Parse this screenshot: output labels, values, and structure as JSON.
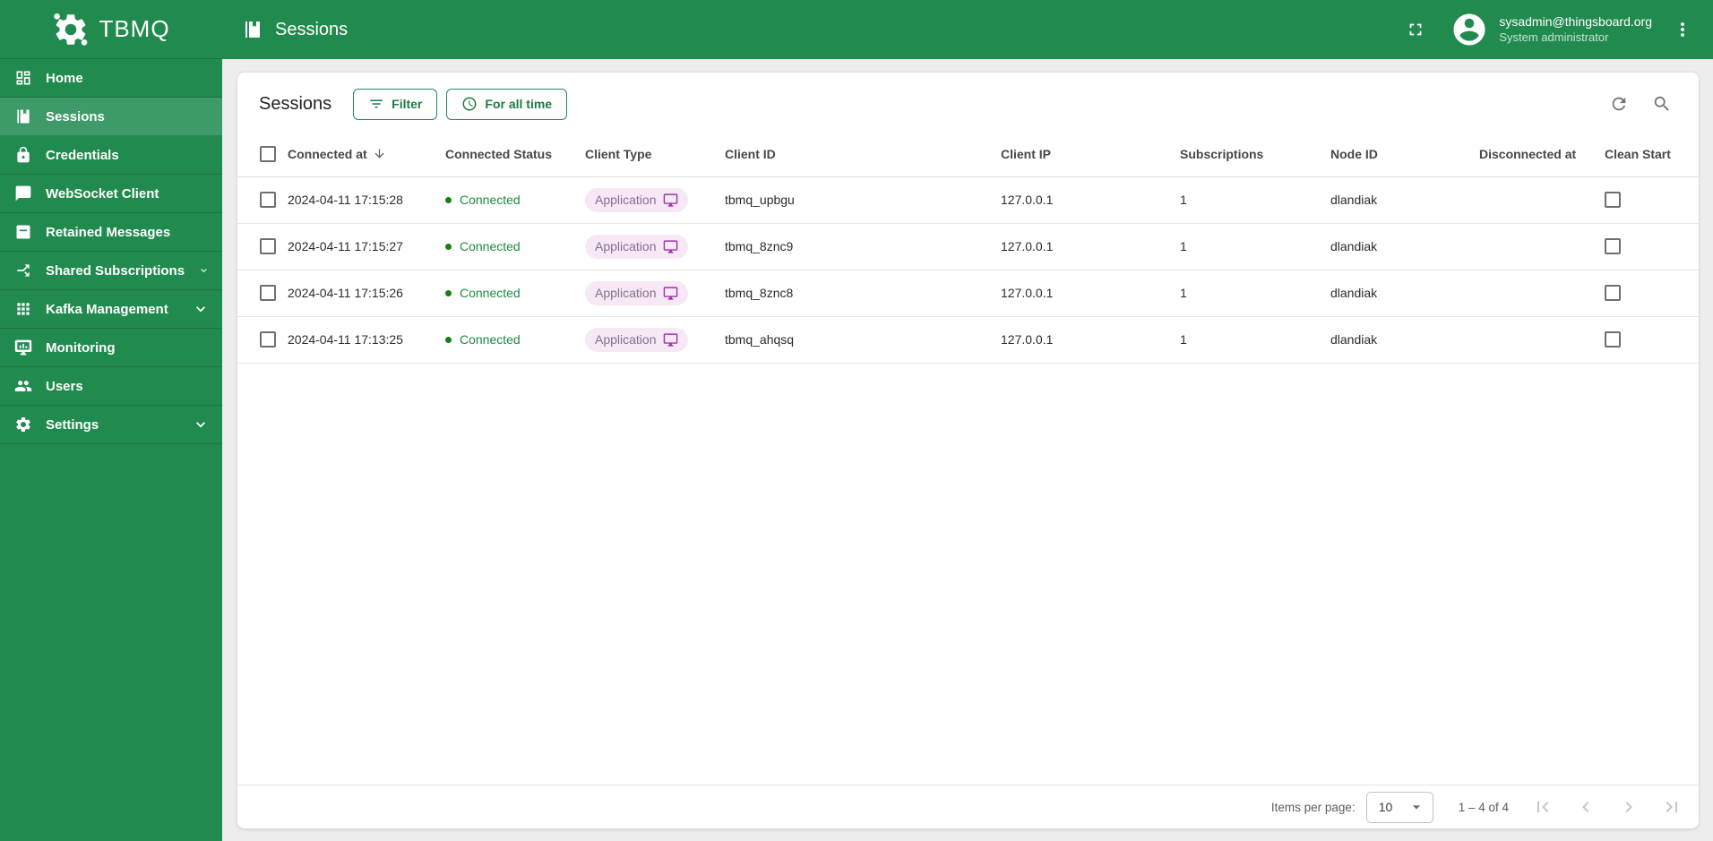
{
  "sidebar": {
    "logo_text": "TBMQ",
    "items": [
      {
        "label": "Home",
        "slug": "home",
        "icon": "dashboard",
        "active": false,
        "expandable": false
      },
      {
        "label": "Sessions",
        "slug": "sessions",
        "icon": "book",
        "active": true,
        "expandable": false
      },
      {
        "label": "Credentials",
        "slug": "credentials",
        "icon": "lock",
        "active": false,
        "expandable": false
      },
      {
        "label": "WebSocket Client",
        "slug": "websocket-client",
        "icon": "chat",
        "active": false,
        "expandable": false
      },
      {
        "label": "Retained Messages",
        "slug": "retained-messages",
        "icon": "archive",
        "active": false,
        "expandable": false
      },
      {
        "label": "Shared Subscriptions",
        "slug": "shared-subscriptions",
        "icon": "split",
        "active": false,
        "expandable": true
      },
      {
        "label": "Kafka Management",
        "slug": "kafka-management",
        "icon": "apps",
        "active": false,
        "expandable": true
      },
      {
        "label": "Monitoring",
        "slug": "monitoring",
        "icon": "monitor",
        "active": false,
        "expandable": false
      },
      {
        "label": "Users",
        "slug": "users",
        "icon": "people",
        "active": false,
        "expandable": false
      },
      {
        "label": "Settings",
        "slug": "settings",
        "icon": "gear",
        "active": false,
        "expandable": true
      }
    ]
  },
  "topbar": {
    "title": "Sessions",
    "user_email": "sysadmin@thingsboard.org",
    "user_role": "System administrator"
  },
  "main": {
    "title": "Sessions",
    "filter_label": "Filter",
    "time_label": "For all time",
    "table": {
      "headers": {
        "connected_at": "Connected at",
        "connected_status": "Connected Status",
        "client_type": "Client Type",
        "client_id": "Client ID",
        "client_ip": "Client IP",
        "subscriptions": "Subscriptions",
        "node_id": "Node ID",
        "disconnected_at": "Disconnected at",
        "clean_start": "Clean Start"
      },
      "rows": [
        {
          "connected_at": "2024-04-11 17:15:28",
          "status": "Connected",
          "client_type": "Application",
          "client_id": "tbmq_upbgu",
          "client_ip": "127.0.0.1",
          "subscriptions": "1",
          "node_id": "dlandiak",
          "disconnected_at": "",
          "clean_start": false
        },
        {
          "connected_at": "2024-04-11 17:15:27",
          "status": "Connected",
          "client_type": "Application",
          "client_id": "tbmq_8znc9",
          "client_ip": "127.0.0.1",
          "subscriptions": "1",
          "node_id": "dlandiak",
          "disconnected_at": "",
          "clean_start": false
        },
        {
          "connected_at": "2024-04-11 17:15:26",
          "status": "Connected",
          "client_type": "Application",
          "client_id": "tbmq_8znc8",
          "client_ip": "127.0.0.1",
          "subscriptions": "1",
          "node_id": "dlandiak",
          "disconnected_at": "",
          "clean_start": false
        },
        {
          "connected_at": "2024-04-11 17:13:25",
          "status": "Connected",
          "client_type": "Application",
          "client_id": "tbmq_ahqsq",
          "client_ip": "127.0.0.1",
          "subscriptions": "1",
          "node_id": "dlandiak",
          "disconnected_at": "",
          "clean_start": false
        }
      ]
    },
    "pagination": {
      "items_per_page_label": "Items per page:",
      "page_size": "10",
      "range": "1 – 4 of 4"
    }
  },
  "colors": {
    "primary_green": "#218b4f",
    "sidebar_active_green": "#3e9a68",
    "status_green": "#1e8a42",
    "chip_bg": "#f7e8f6",
    "chip_icon_purple": "#a232a8"
  }
}
